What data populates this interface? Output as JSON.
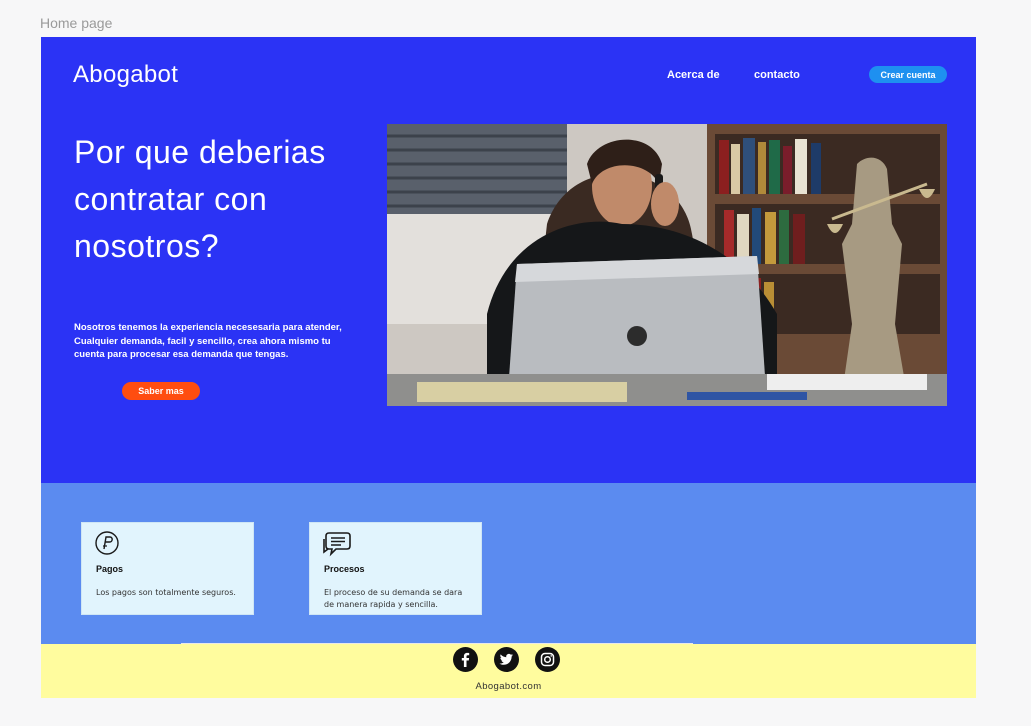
{
  "frame": {
    "label": "Home page"
  },
  "header": {
    "brand": "Abogabot",
    "nav": {
      "about": "Acerca de",
      "contact": "contacto"
    },
    "signup_label": "Crear cuenta"
  },
  "hero": {
    "headline": "Por que deberias contratar con nosotros?",
    "intro": "Nosotros tenemos la experiencia necesesaria para atender, Cualquier demanda, facil y sencillo, crea ahora mismo tu cuenta para procesar esa demanda que tengas.",
    "cta_label": "Saber mas",
    "image_icon": "lawyer-photo"
  },
  "features": [
    {
      "icon": "payment-icon",
      "title": "Pagos",
      "text": "Los pagos son totalmente seguros."
    },
    {
      "icon": "chat-icon",
      "title": "Procesos",
      "text": "El proceso de su demanda se dara de manera rapida y sencilla."
    }
  ],
  "footer": {
    "social": [
      "facebook-icon",
      "twitter-icon",
      "instagram-icon"
    ],
    "site": "Abogabot.com"
  },
  "colors": {
    "hero_bg": "#2b33f5",
    "features_bg": "#5b8bf0",
    "footer_bg": "#fffc9e",
    "signup_button": "#1e90f0",
    "cta_button": "#ff4d10",
    "card_bg": "#e1f4fd"
  }
}
